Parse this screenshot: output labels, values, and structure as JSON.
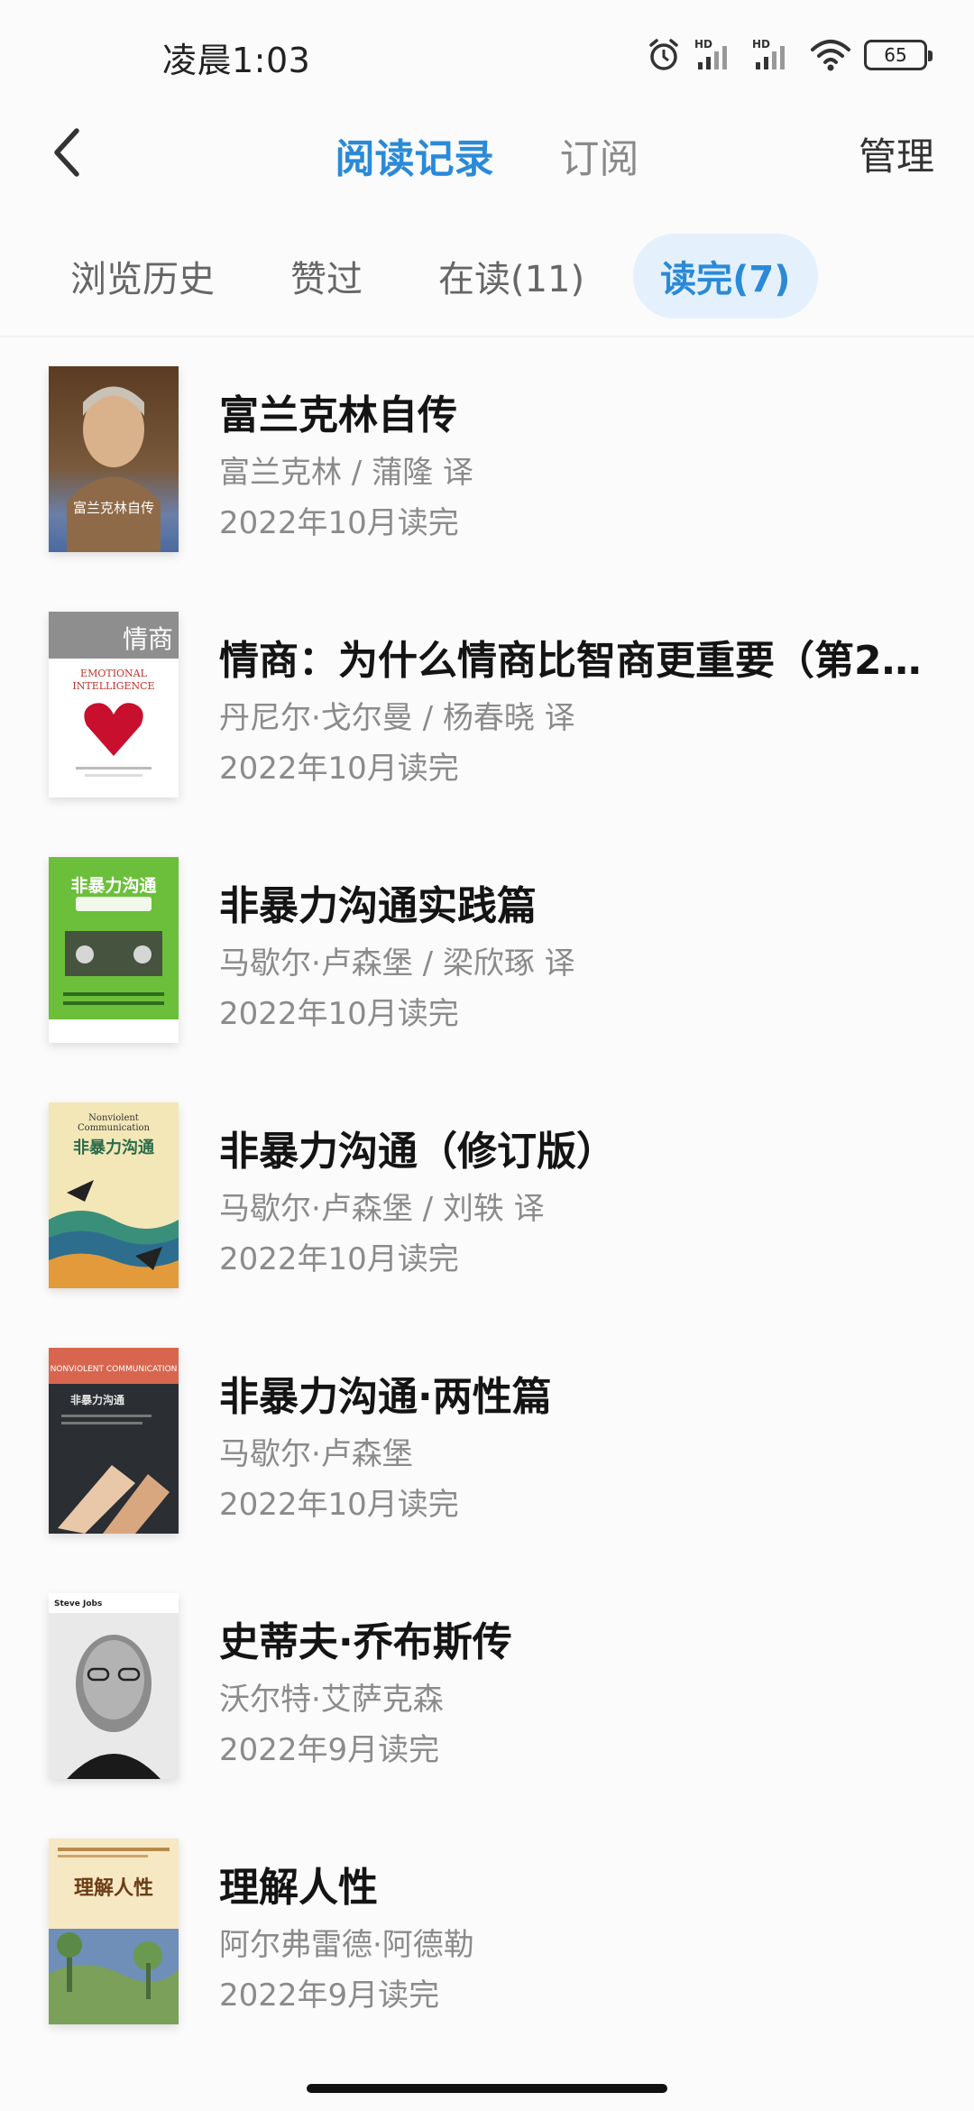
{
  "status_bar": {
    "time": "凌晨1:03",
    "battery": "65",
    "icons": [
      "alarm-icon",
      "signal-hd-icon",
      "signal-hd-icon",
      "wifi-icon",
      "battery-icon"
    ]
  },
  "nav": {
    "back_icon": "back-arrow-icon",
    "tabs": [
      {
        "label": "阅读记录",
        "active": true
      },
      {
        "label": "订阅",
        "active": false
      }
    ],
    "manage_label": "管理"
  },
  "sub_tabs": [
    {
      "label": "浏览历史",
      "active": false
    },
    {
      "label": "赞过",
      "active": false
    },
    {
      "label": "在读(11)",
      "active": false
    },
    {
      "label": "读完(7)",
      "active": true
    }
  ],
  "books": [
    {
      "title": "富兰克林自传",
      "author": "富兰克林 / 蒲隆 译",
      "finished": "2022年10月读完",
      "cover_caption": "富兰克林自传"
    },
    {
      "title": "情商：为什么情商比智商更重要（第2…",
      "author": "丹尼尔·戈尔曼 / 杨春晓 译",
      "finished": "2022年10月读完",
      "cover_caption": "情商"
    },
    {
      "title": "非暴力沟通实践篇",
      "author": "马歇尔·卢森堡 / 梁欣琢 译",
      "finished": "2022年10月读完",
      "cover_caption": "非暴力沟通"
    },
    {
      "title": "非暴力沟通（修订版）",
      "author": "马歇尔·卢森堡 / 刘轶 译",
      "finished": "2022年10月读完",
      "cover_caption": "非暴力沟通"
    },
    {
      "title": "非暴力沟通·两性篇",
      "author": "马歇尔·卢森堡",
      "finished": "2022年10月读完",
      "cover_caption": "NONVIOLENT COMMUNICATION"
    },
    {
      "title": "史蒂夫·乔布斯传",
      "author": "沃尔特·艾萨克森",
      "finished": "2022年9月读完",
      "cover_caption": "Steve Jobs"
    },
    {
      "title": "理解人性",
      "author": "阿尔弗雷德·阿德勒",
      "finished": "2022年9月读完",
      "cover_caption": "理解人性"
    }
  ],
  "colors": {
    "accent": "#2a8ad8",
    "active_tab_bg": "#e4f1fc",
    "muted_text": "#8b8b8b"
  }
}
